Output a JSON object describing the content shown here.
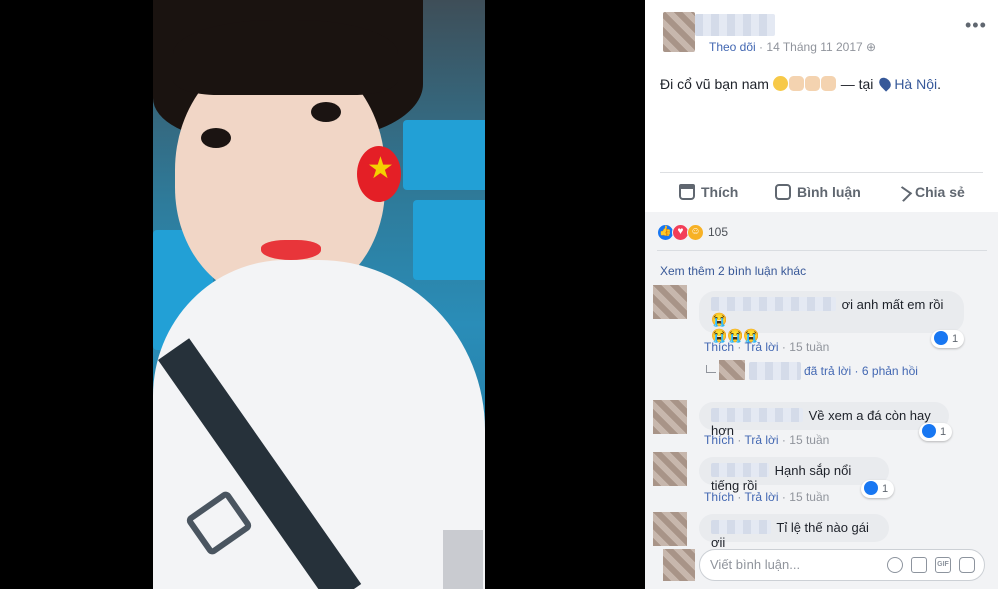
{
  "post": {
    "follow_label": "Theo dõi",
    "date": "14 Tháng 11 2017",
    "privacy_glyph": "·",
    "more_label": "•••",
    "text_before": "Đi cổ vũ bạn nam ",
    "text_middle": " — tại ",
    "place": "Hà Nội",
    "text_after": ".",
    "emojis": [
      "laugh",
      "clap",
      "clap",
      "clap"
    ]
  },
  "actions": {
    "like": "Thích",
    "comment": "Bình luận",
    "share": "Chia sẻ"
  },
  "reactions": {
    "count": "105",
    "types": [
      "like",
      "love",
      "haha"
    ],
    "colors": {
      "like": "#1877f2",
      "love": "#f33e58",
      "haha": "#f7b125"
    }
  },
  "comments": {
    "view_more": "Xem thêm 2 bình luận khác",
    "items": [
      {
        "text": "ơi anh mất em rồi 😭",
        "text2": "😭😭😭",
        "like": "Thích",
        "reply": "Trả lời",
        "time": "15 tuần",
        "likes": "1",
        "reply_summary": "đã trả lời · 6 phản hồi"
      },
      {
        "text": "Về xem a đá còn hay hơn",
        "like": "Thích",
        "reply": "Trả lời",
        "time": "15 tuần",
        "likes": "1"
      },
      {
        "text": "Hạnh sắp nổi tiếng rồi",
        "like": "Thích",
        "reply": "Trả lời",
        "time": "15 tuần",
        "likes": "1"
      },
      {
        "text": "Tỉ lệ thế nào gái ơii"
      }
    ],
    "dot": "·",
    "input_placeholder": "Viết bình luận...",
    "gif_label": "GIF"
  }
}
